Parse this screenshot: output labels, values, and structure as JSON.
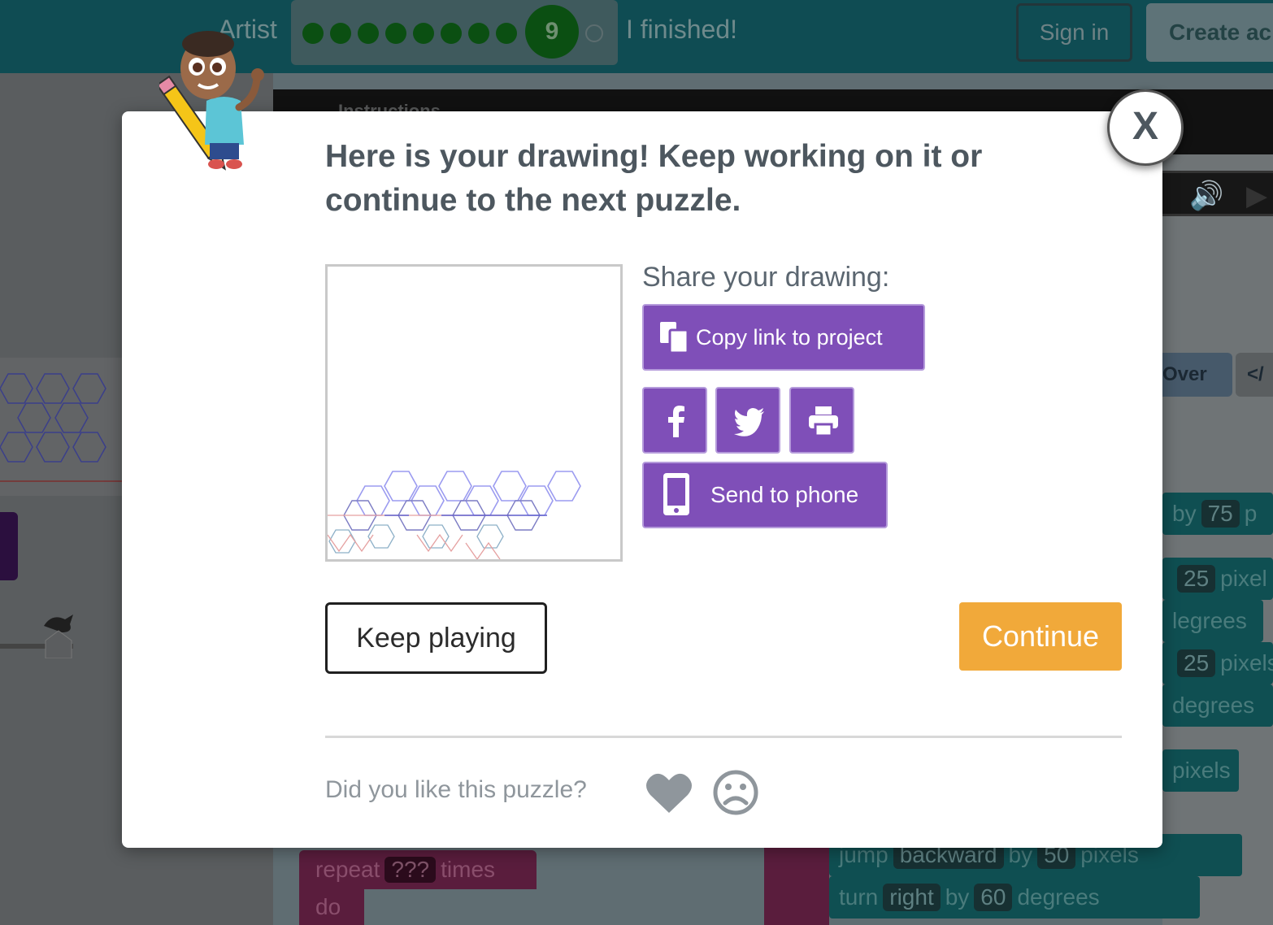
{
  "header": {
    "level_name": "Artist",
    "current_puzzle": "9",
    "finished_label": "I finished!",
    "sign_in": "Sign in",
    "create_account": "Create ac"
  },
  "workspace": {
    "instructions_label": "Instructions",
    "over_label": "Over",
    "code_label": "</",
    "blocks": [
      {
        "pre": "by",
        "value": "75",
        "post": "p"
      },
      {
        "pre": "",
        "value": "25",
        "post": "pixel"
      },
      {
        "pre": "",
        "value": "",
        "post": "legrees"
      },
      {
        "pre": "",
        "value": "25",
        "post": "pixels"
      },
      {
        "pre": "",
        "value": "",
        "post": "degrees"
      },
      {
        "pre": "",
        "value": "",
        "post": "pixels"
      },
      {
        "pre": "jump",
        "select": "backward",
        "mid": "by",
        "value": "50",
        "post": "pixels"
      },
      {
        "pre": "turn",
        "select": "right",
        "mid": "by",
        "value": "60",
        "post": "degrees"
      }
    ],
    "repeat": {
      "label": "repeat",
      "value": "???",
      "suffix": "times",
      "do": "do"
    }
  },
  "modal": {
    "headline": "Here is your drawing! Keep working on it or continue to the next puzzle.",
    "share_label": "Share your drawing:",
    "copy_link": "Copy link to project",
    "send_to_phone": "Send to phone",
    "keep_playing": "Keep playing",
    "continue": "Continue",
    "feedback_question": "Did you like this puzzle?",
    "close": "X"
  },
  "icons": {
    "copy": "clipboard-icon",
    "facebook": "facebook-icon",
    "twitter": "twitter-icon",
    "print": "print-icon",
    "phone": "mobile-phone-icon",
    "like": "heart-icon",
    "dislike": "frown-icon"
  },
  "colors": {
    "brand_purple": "#7f4fb8",
    "continue_orange": "#f1a93a",
    "header_teal": "#0f4c53",
    "text_dark": "#4d575f"
  }
}
